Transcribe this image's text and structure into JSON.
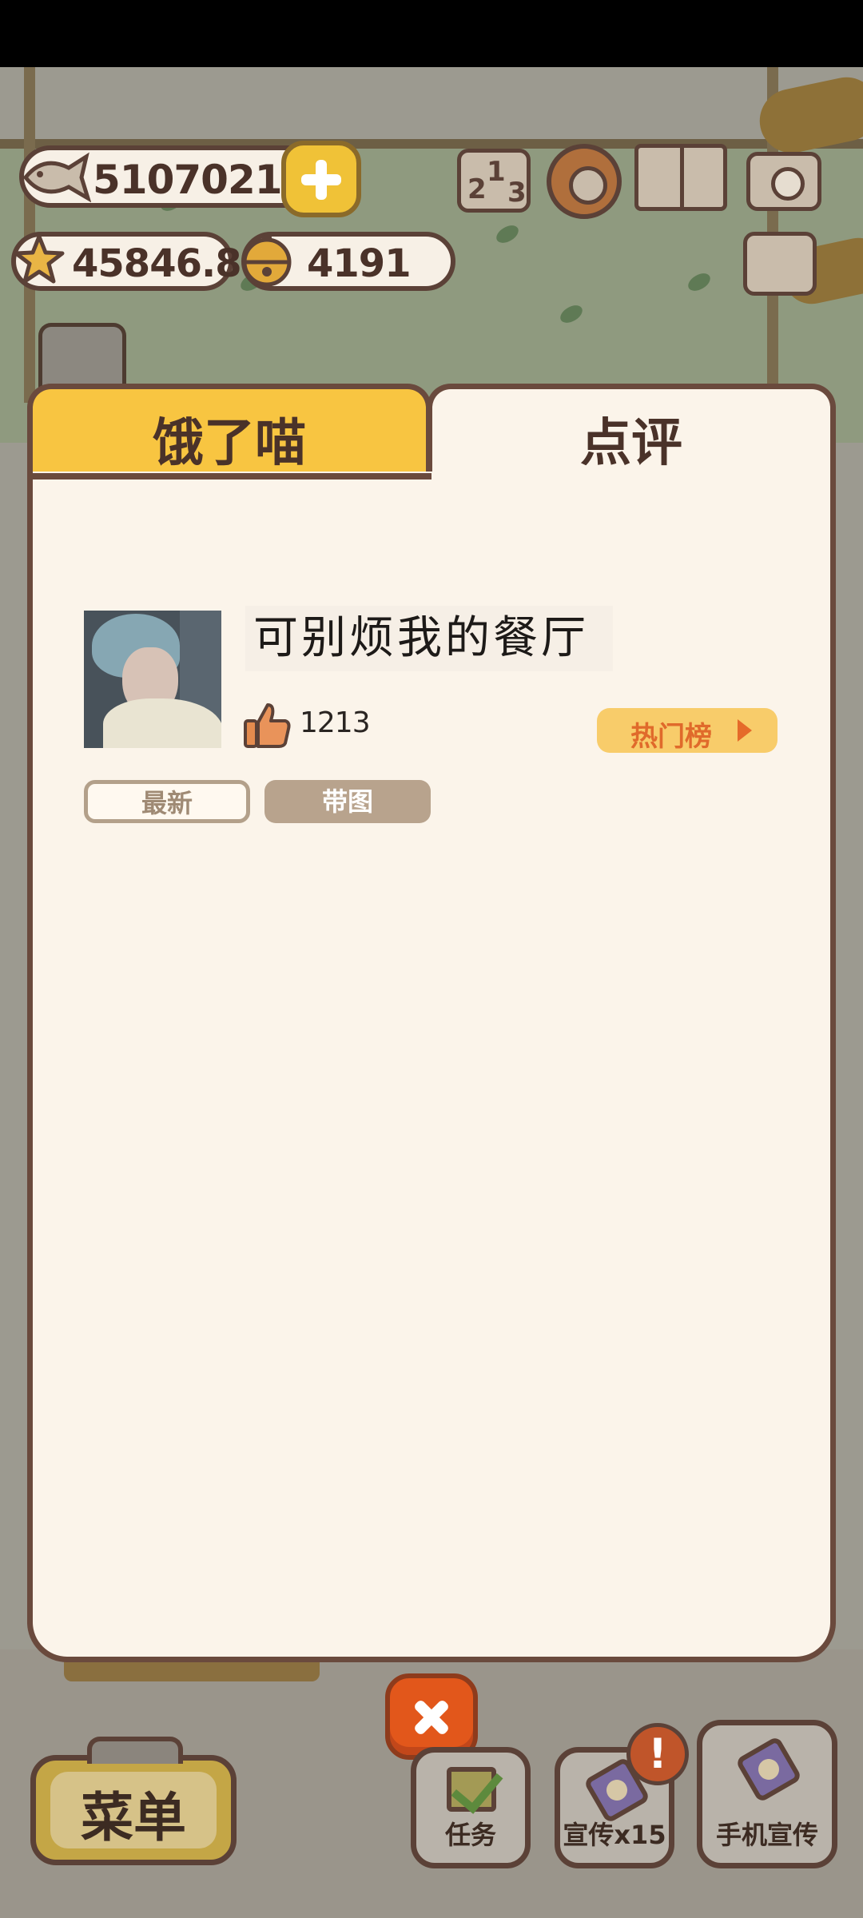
{
  "hud": {
    "fish_count": "5107021",
    "star_rating": "45846.8",
    "bell_count": "4191"
  },
  "panel": {
    "tabs": [
      {
        "label": "饿了喵",
        "active": false
      },
      {
        "label": "点评",
        "active": true
      }
    ],
    "review": {
      "restaurant_name": "可别烦我的餐厅",
      "likes": "1213",
      "hot_list_label": "热门榜"
    },
    "filters": [
      {
        "label": "最新",
        "selected": false
      },
      {
        "label": "带图",
        "selected": true
      }
    ]
  },
  "bottom_bar": {
    "menu_label": "菜单",
    "task_label": "任务",
    "promo_label": "宣传x15",
    "phone_promo_label": "手机宣传",
    "alert_badge": "!"
  },
  "colors": {
    "accent": "#f8c541",
    "panel_bg": "#fbf4ea",
    "close_button": "#e2571b",
    "hot_list_text": "#e06a2b"
  }
}
